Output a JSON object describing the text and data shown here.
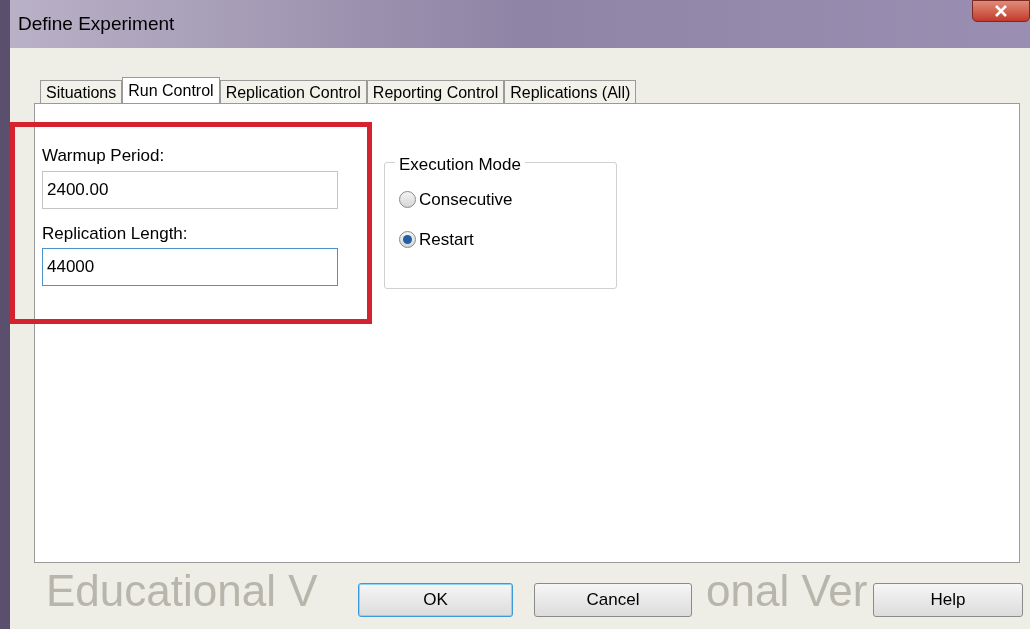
{
  "window": {
    "title": "Define Experiment"
  },
  "tabs": [
    {
      "label": "Situations",
      "selected": false
    },
    {
      "label": "Run Control",
      "selected": true
    },
    {
      "label": "Replication Control",
      "selected": false
    },
    {
      "label": "Reporting Control",
      "selected": false
    },
    {
      "label": "Replications (All)",
      "selected": false
    }
  ],
  "fields": [
    {
      "label": "Warmup Period:",
      "value": "2400.00",
      "focused": false
    },
    {
      "label": "Replication Length:",
      "value": "44000",
      "focused": true
    }
  ],
  "execution_mode": {
    "title": "Execution Mode",
    "options": [
      {
        "label": "Consecutive",
        "selected": false
      },
      {
        "label": "Restart",
        "selected": true
      }
    ]
  },
  "watermark": [
    "Educational V",
    "onal Ver"
  ],
  "buttons": [
    {
      "label": "OK",
      "default": true
    },
    {
      "label": "Cancel",
      "default": false
    },
    {
      "label": "Help",
      "default": false
    }
  ]
}
